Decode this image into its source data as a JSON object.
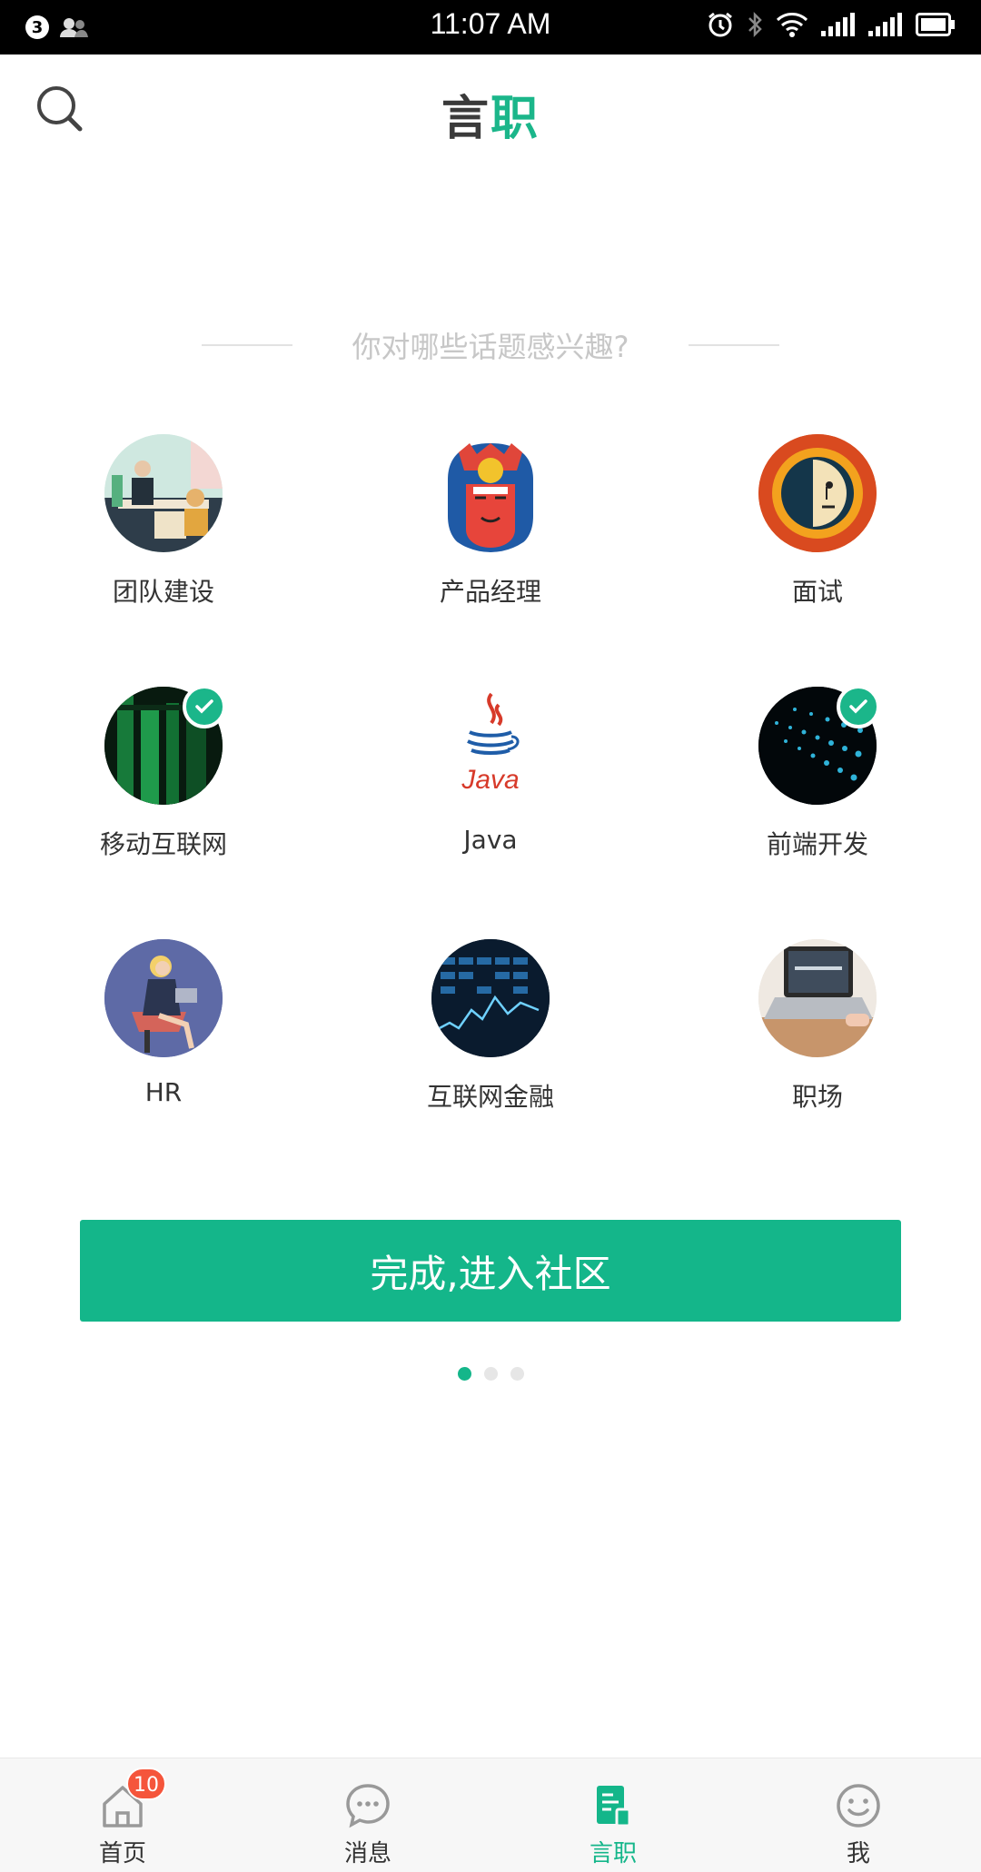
{
  "status_bar": {
    "notification_count": "3",
    "time": "11:07 AM"
  },
  "header": {
    "title_part1": "言",
    "title_part2": "职"
  },
  "prompt": "你对哪些话题感兴趣?",
  "topics": [
    {
      "label": "团队建设",
      "selected": false
    },
    {
      "label": "产品经理",
      "selected": false
    },
    {
      "label": "面试",
      "selected": false
    },
    {
      "label": "移动互联网",
      "selected": true
    },
    {
      "label": "Java",
      "selected": false
    },
    {
      "label": "前端开发",
      "selected": true
    },
    {
      "label": "HR",
      "selected": false
    },
    {
      "label": "互联网金融",
      "selected": false
    },
    {
      "label": "职场",
      "selected": false
    }
  ],
  "java_logo_text": "Java",
  "done_button": "完成,进入社区",
  "pagination": {
    "total": 3,
    "current": 1
  },
  "bottom_nav": [
    {
      "label": "首页",
      "icon": "home-icon",
      "badge": "10"
    },
    {
      "label": "消息",
      "icon": "message-icon"
    },
    {
      "label": "言职",
      "icon": "yanzhi-icon",
      "active": true
    },
    {
      "label": "我",
      "icon": "smile-icon"
    }
  ],
  "colors": {
    "accent": "#14b68a",
    "badge": "#f5553b"
  }
}
